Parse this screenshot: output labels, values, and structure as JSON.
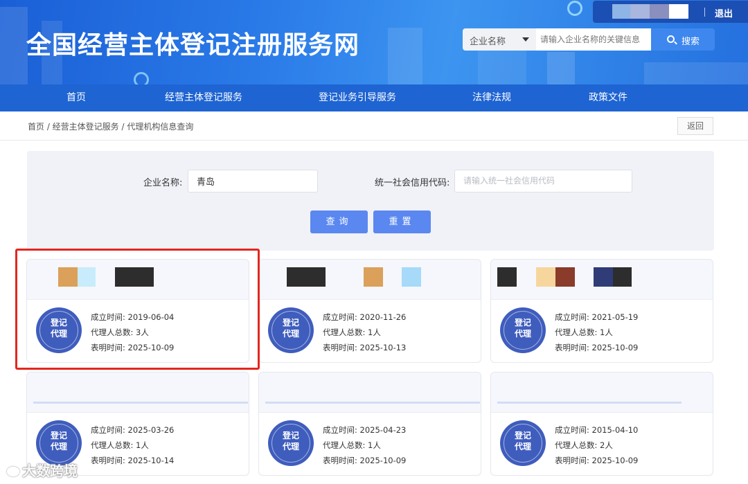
{
  "header": {
    "site_title": "全国经营主体登记注册服务网",
    "logout_label": "退出",
    "search": {
      "select_value": "企业名称",
      "placeholder": "请输入企业名称的关键信息",
      "button_label": "搜索"
    },
    "colors": {
      "primary": "#1e64d2",
      "accent": "#3d87ee"
    }
  },
  "nav": {
    "items": [
      {
        "label": "首页"
      },
      {
        "label": "经营主体登记服务"
      },
      {
        "label": "登记业务引导服务"
      },
      {
        "label": "法律法规"
      },
      {
        "label": "政策文件"
      }
    ]
  },
  "breadcrumb": {
    "text": "首页 / 经营主体登记服务 / 代理机构信息查询",
    "back_label": "返回"
  },
  "filter": {
    "company_name_label": "企业名称:",
    "company_name_value": "青岛",
    "credit_code_label": "统一社会信用代码:",
    "credit_code_placeholder": "请输入统一社会信用代码",
    "query_label": "查询",
    "reset_label": "重置"
  },
  "cards": [
    {
      "badge": [
        "登记",
        "代理"
      ],
      "founded": "成立时间: 2019-06-04",
      "agents": "代理人总数: 3人",
      "declared": "表明时间: 2025-10-09",
      "highlighted": true
    },
    {
      "badge": [
        "登记",
        "代理"
      ],
      "founded": "成立时间: 2020-11-26",
      "agents": "代理人总数: 1人",
      "declared": "表明时间: 2025-10-13"
    },
    {
      "badge": [
        "登记",
        "代理"
      ],
      "founded": "成立时间: 2021-05-19",
      "agents": "代理人总数: 1人",
      "declared": "表明时间: 2025-10-09"
    },
    {
      "badge": [
        "登记",
        "代理"
      ],
      "founded": "成立时间: 2025-03-26",
      "agents": "代理人总数: 1人",
      "declared": "表明时间: 2025-10-14"
    },
    {
      "badge": [
        "登记",
        "代理"
      ],
      "founded": "成立时间: 2025-04-23",
      "agents": "代理人总数: 1人",
      "declared": "表明时间: 2025-10-09"
    },
    {
      "badge": [
        "登记",
        "代理"
      ],
      "founded": "成立时间: 2015-04-10",
      "agents": "代理人总数: 2人",
      "declared": "表明时间: 2025-10-09"
    }
  ],
  "watermark": "大数跨境"
}
